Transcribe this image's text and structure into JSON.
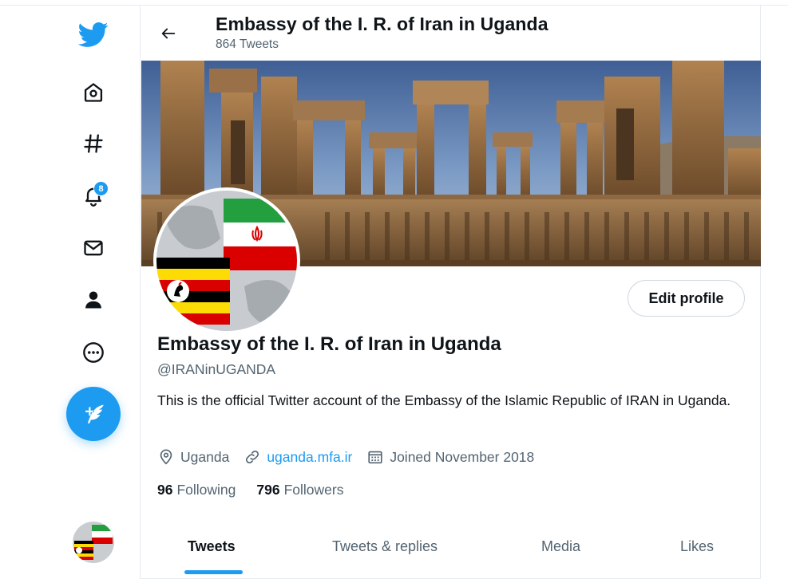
{
  "header": {
    "title": "Embassy of the I. R. of Iran in Uganda",
    "tweet_count": "864 Tweets"
  },
  "sidebar": {
    "items": [
      {
        "icon": "twitter-logo-icon"
      },
      {
        "icon": "home-icon"
      },
      {
        "icon": "explore-hashtag-icon"
      },
      {
        "icon": "notifications-bell-icon",
        "badge": "8"
      },
      {
        "icon": "messages-envelope-icon"
      },
      {
        "icon": "profile-person-icon"
      },
      {
        "icon": "more-icon"
      }
    ],
    "tweet_button_icon": "compose-tweet-icon"
  },
  "profile": {
    "name": "Embassy of the I. R. of Iran in Uganda",
    "handle": "@IRANinUGANDA",
    "bio": "This is the official Twitter account of the Embassy of the Islamic Republic of IRAN in Uganda.",
    "location": "Uganda",
    "website": "uganda.mfa.ir",
    "joined": "Joined November 2018",
    "following_count": "96",
    "following_label": "Following",
    "followers_count": "796",
    "followers_label": "Followers",
    "edit_button": "Edit profile"
  },
  "tabs": [
    {
      "label": "Tweets",
      "active": true
    },
    {
      "label": "Tweets & replies",
      "active": false
    },
    {
      "label": "Media",
      "active": false
    },
    {
      "label": "Likes",
      "active": false
    }
  ],
  "colors": {
    "accent": "#1d9bf0",
    "text_primary": "#0f1419",
    "text_secondary": "#536471",
    "border": "#e6ecf0"
  }
}
